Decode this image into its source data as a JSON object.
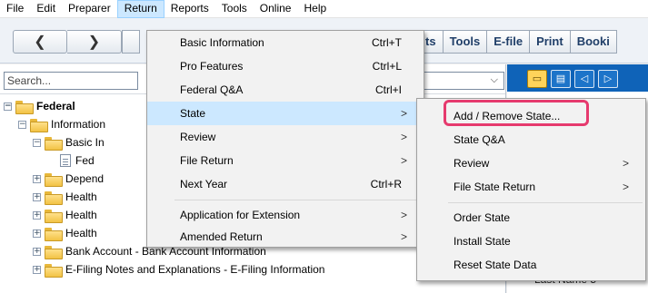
{
  "menubar": [
    "File",
    "Edit",
    "Preparer",
    "Return",
    "Reports",
    "Tools",
    "Online",
    "Help"
  ],
  "toolbar": {
    "back": "❮",
    "forward": "❯",
    "buttons": [
      "ts",
      "Tools",
      "E-file",
      "Print",
      "Booki"
    ]
  },
  "search": {
    "placeholder": "Search..."
  },
  "tree": [
    {
      "label": "Federal",
      "pm": "−",
      "bold": true
    },
    {
      "label": "Information",
      "pm": "−"
    },
    {
      "label": "Basic In",
      "pm": "−"
    },
    {
      "label": "Fed",
      "doc": true
    },
    {
      "label": "Depend",
      "pm": "+"
    },
    {
      "label": "Health",
      "pm": "+"
    },
    {
      "label": "Health",
      "pm": "+"
    },
    {
      "label": "Health",
      "pm": "+"
    },
    {
      "label": "Bank Account -  Bank Account Information",
      "pm": "+"
    },
    {
      "label": "E-Filing Notes and Explanations -  E-Filing Information",
      "pm": "+"
    }
  ],
  "return_menu": {
    "items": [
      {
        "label": "Basic Information",
        "shortcut": "Ctrl+T"
      },
      {
        "label": "Pro Features",
        "shortcut": "Ctrl+L"
      },
      {
        "label": "Federal Q&A",
        "shortcut": "Ctrl+I"
      },
      {
        "label": "State",
        "submenu": true
      },
      {
        "label": "Review",
        "submenu": true
      },
      {
        "label": "File Return",
        "submenu": true
      },
      {
        "label": "Next Year",
        "shortcut": "Ctrl+R"
      },
      {
        "label": "Application for Extension",
        "submenu": true
      },
      {
        "label": "Amended Return",
        "submenu": true
      }
    ]
  },
  "state_menu": {
    "items": [
      {
        "label": "Add / Remove State..."
      },
      {
        "label": "State Q&A"
      },
      {
        "label": "Review",
        "submenu": true
      },
      {
        "label": "File State Return",
        "submenu": true
      },
      {
        "label": "Order State"
      },
      {
        "label": "Install State"
      },
      {
        "label": "Reset State Data"
      }
    ]
  },
  "right": {
    "trim": "N",
    "partial": "Last Name 5"
  },
  "colors": {
    "highlight": "#cce8ff",
    "callout": "#e63a6e",
    "right_toolbar": "#0f63b8"
  }
}
